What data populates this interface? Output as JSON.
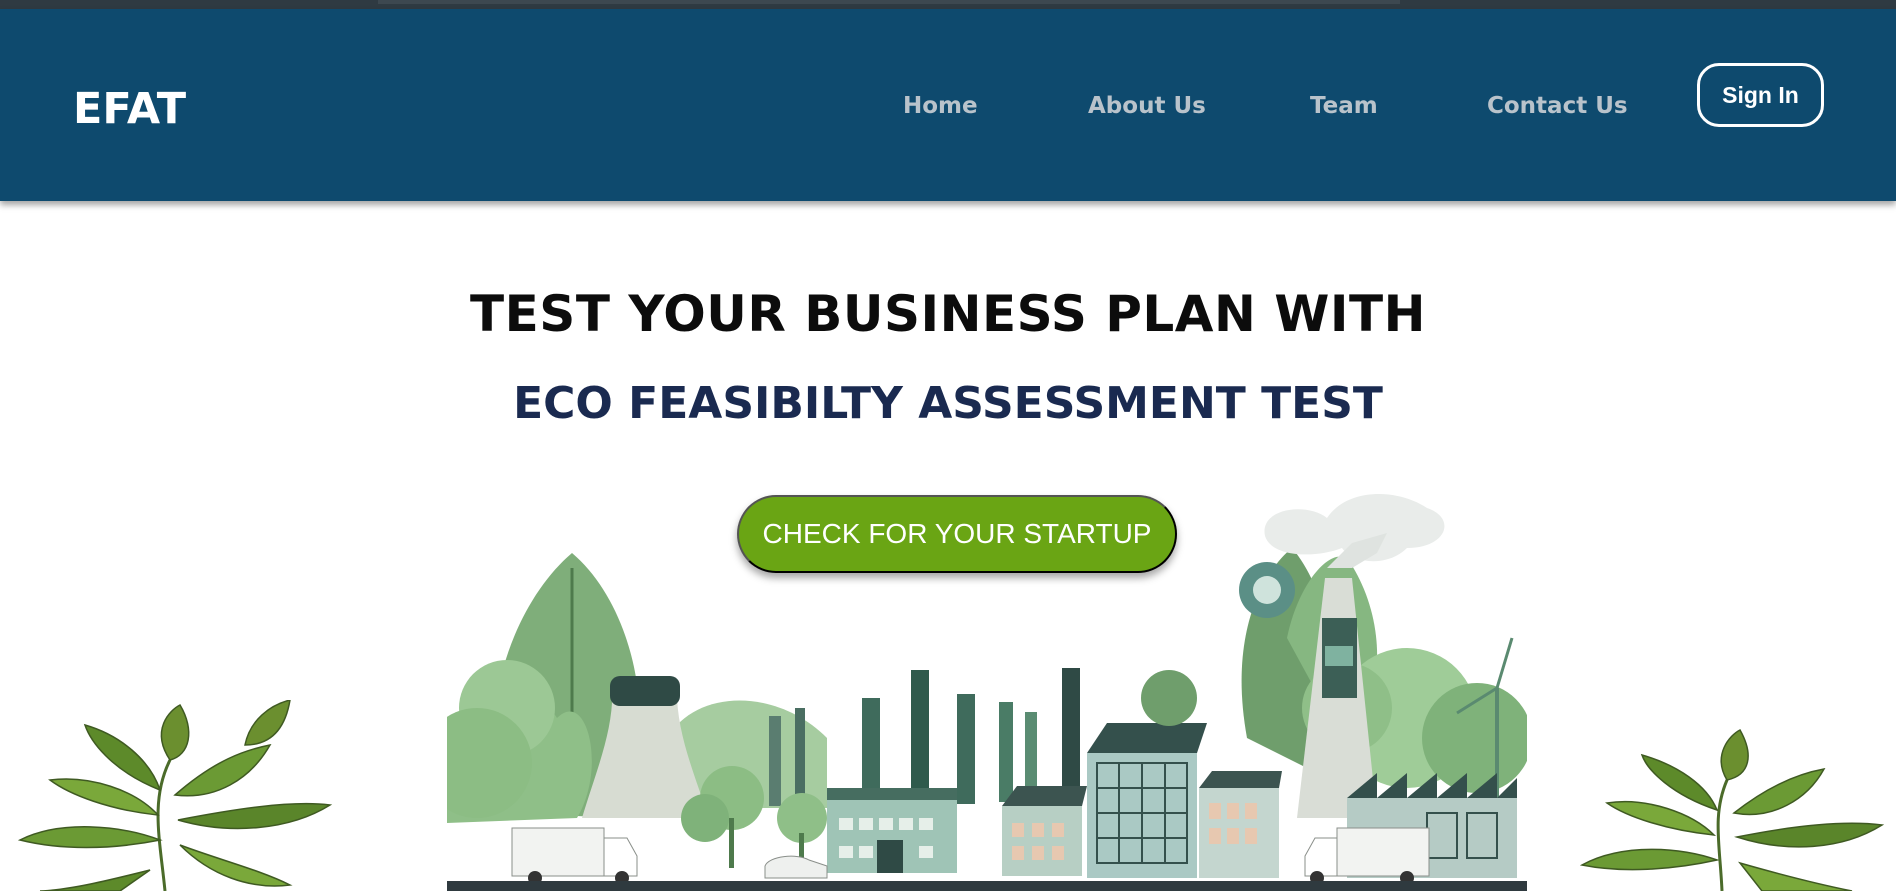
{
  "navbar": {
    "logo": "EFAT",
    "links": [
      {
        "label": "Home"
      },
      {
        "label": "About Us"
      },
      {
        "label": "Team"
      },
      {
        "label": "Contact Us"
      }
    ],
    "signin_label": "Sign In"
  },
  "hero": {
    "title": "TEST YOUR BUSINESS PLAN WITH",
    "subtitle": "ECO FEASIBILTY ASSESSMENT TEST",
    "cta_label": "CHECK FOR YOUR STARTUP"
  },
  "colors": {
    "navbar_bg": "#0e4a6e",
    "cta_bg": "#6aa514",
    "subtitle": "#1a2a50"
  },
  "images": {
    "illustration": "eco-industrial-city-illustration",
    "plant_left": "green-leaf-plant",
    "plant_right": "green-leaf-plant"
  }
}
